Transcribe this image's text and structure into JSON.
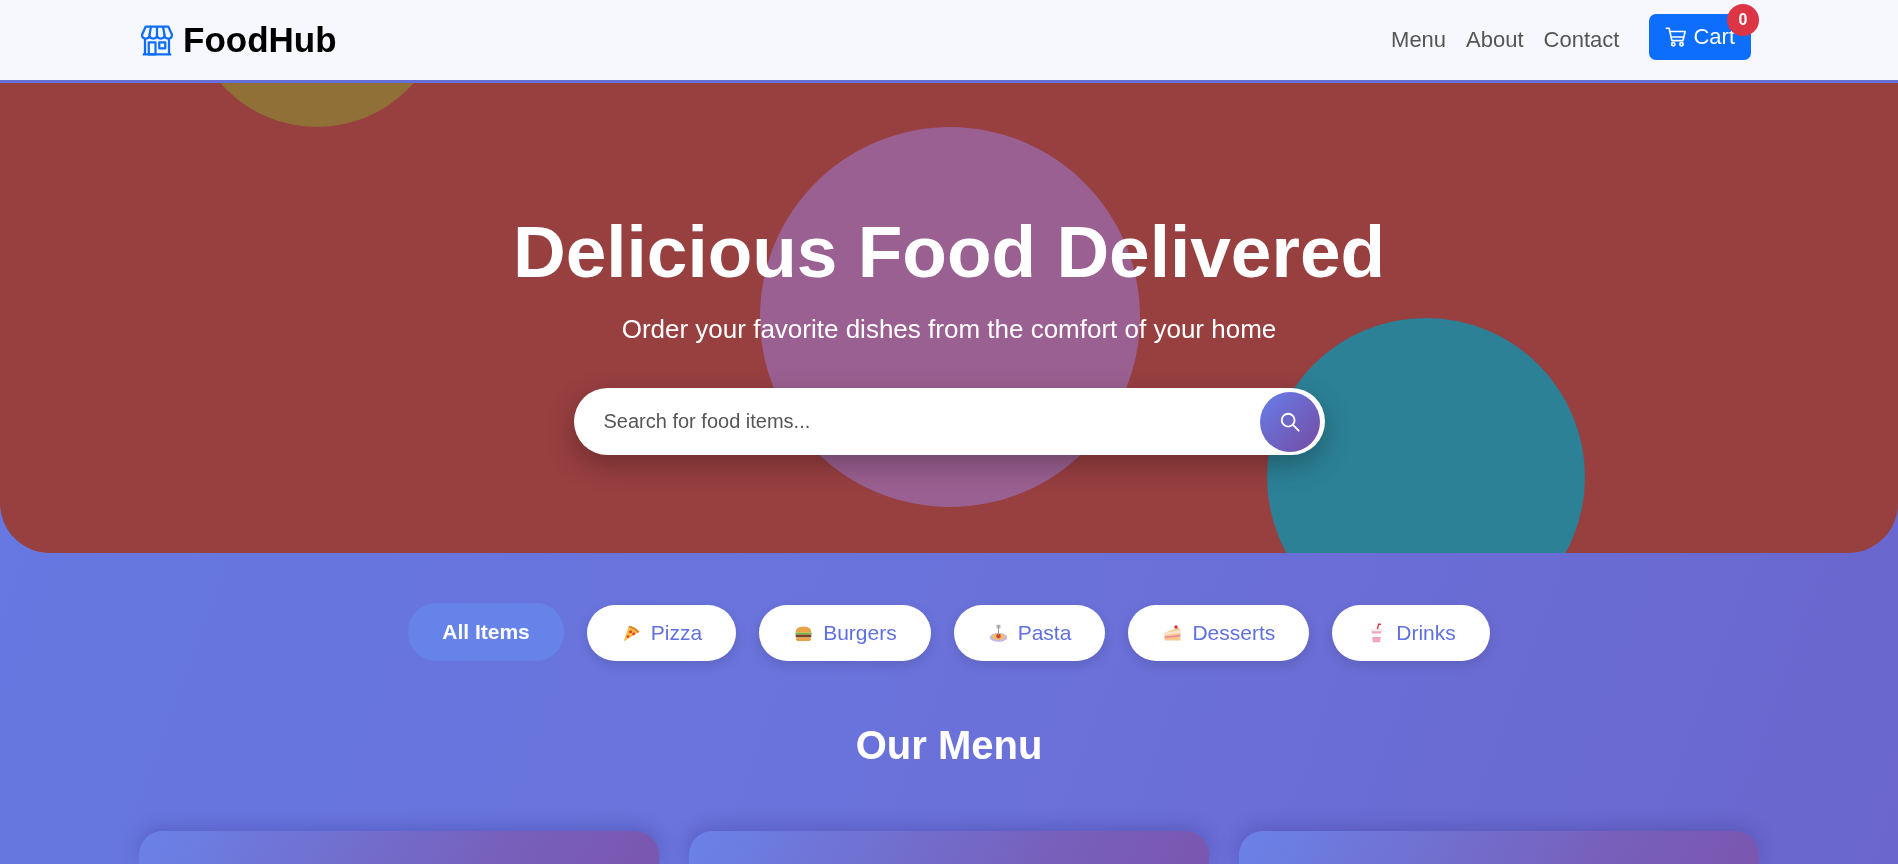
{
  "navbar": {
    "brand": "FoodHub",
    "links": [
      {
        "label": "Menu"
      },
      {
        "label": "About"
      },
      {
        "label": "Contact"
      }
    ],
    "cart": {
      "label": "Cart",
      "badge": "0"
    }
  },
  "hero": {
    "title": "Delicious Food Delivered",
    "subtitle": "Order your favorite dishes from the comfort of your home",
    "search": {
      "placeholder": "Search for food items..."
    }
  },
  "categories": [
    {
      "label": "All Items",
      "kind": "all",
      "selected": true
    },
    {
      "label": "Pizza",
      "kind": "pizza",
      "selected": false
    },
    {
      "label": "Burgers",
      "kind": "burger",
      "selected": false
    },
    {
      "label": "Pasta",
      "kind": "pasta",
      "selected": false
    },
    {
      "label": "Desserts",
      "kind": "cake",
      "selected": false
    },
    {
      "label": "Drinks",
      "kind": "drink",
      "selected": false
    }
  ],
  "menu": {
    "title": "Our Menu"
  }
}
